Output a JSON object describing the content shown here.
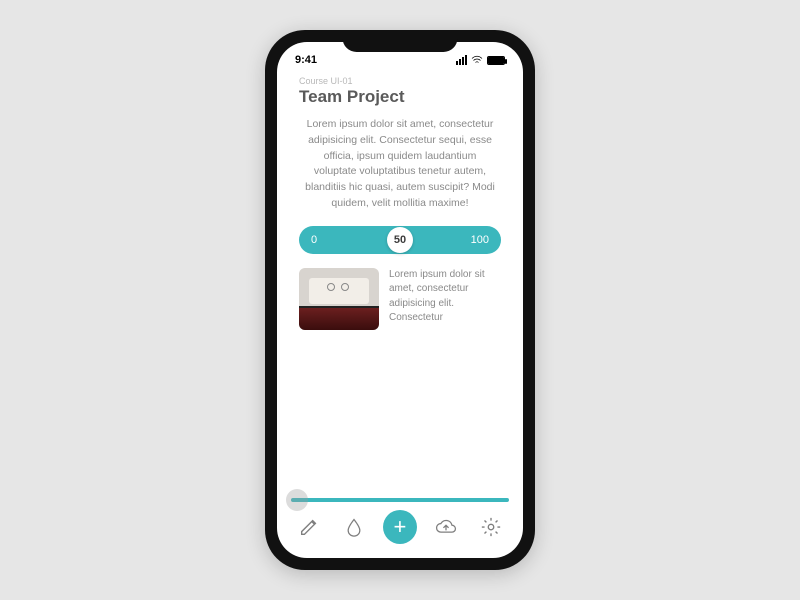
{
  "status": {
    "time": "9:41"
  },
  "header": {
    "course_label": "Course UI-01",
    "title": "Team Project"
  },
  "description": "Lorem ipsum dolor sit amet, consectetur adipisicing elit. Consectetur sequi, esse officia, ipsum quidem laudantium voluptate voluptatibus tenetur autem, blanditiis hic quasi, autem suscipit? Modi quidem, velit mollitia maxime!",
  "slider": {
    "min": "0",
    "value": "50",
    "max": "100"
  },
  "card": {
    "text": "Lorem ipsum dolor sit amet, consectetur adipisicing elit. Consectetur"
  },
  "tabbar": {
    "fab_label": "+"
  }
}
